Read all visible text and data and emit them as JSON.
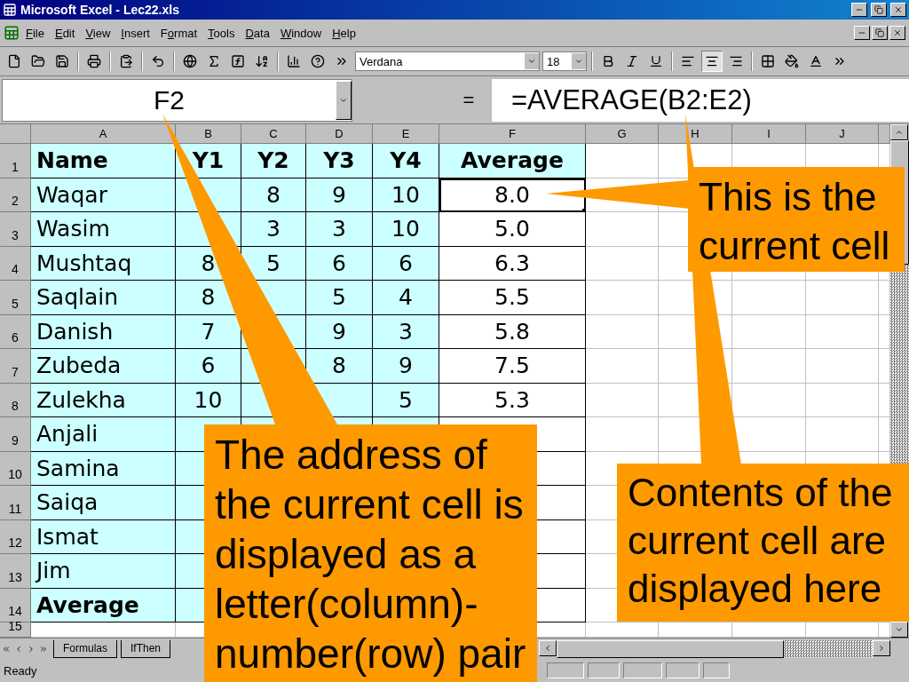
{
  "window": {
    "title": "Microsoft Excel - Lec22.xls"
  },
  "menu": [
    {
      "key": "F",
      "after": "ile"
    },
    {
      "key": "E",
      "after": "dit"
    },
    {
      "key": "V",
      "after": "iew"
    },
    {
      "key": "I",
      "after": "nsert"
    },
    {
      "before": "F",
      "key": "o",
      "after": "rmat"
    },
    {
      "key": "T",
      "after": "ools"
    },
    {
      "key": "D",
      "after": "ata"
    },
    {
      "key": "W",
      "after": "indow"
    },
    {
      "key": "H",
      "after": "elp"
    }
  ],
  "toolbar": [
    {
      "kind": "new",
      "pressed": false
    },
    {
      "kind": "open",
      "pressed": false
    },
    {
      "kind": "save",
      "pressed": false
    },
    {
      "kind": "sep"
    },
    {
      "kind": "print",
      "pressed": false
    },
    {
      "kind": "sep"
    },
    {
      "kind": "paste",
      "pressed": false
    },
    {
      "kind": "sep"
    },
    {
      "kind": "undo",
      "pressed": false
    },
    {
      "kind": "sep"
    },
    {
      "kind": "web",
      "pressed": false
    },
    {
      "kind": "sum",
      "pressed": false
    },
    {
      "kind": "function",
      "pressed": false
    },
    {
      "kind": "sort",
      "pressed": false
    },
    {
      "kind": "sep"
    },
    {
      "kind": "chart",
      "pressed": false
    },
    {
      "kind": "help",
      "pressed": false
    },
    {
      "kind": "more",
      "pressed": false
    }
  ],
  "font": {
    "name": "Verdana",
    "size": "18"
  },
  "format_toolbar": [
    {
      "kind": "bold",
      "pressed": false
    },
    {
      "kind": "italic",
      "pressed": false
    },
    {
      "kind": "underline",
      "pressed": false
    },
    {
      "kind": "sep"
    },
    {
      "kind": "align-left",
      "pressed": false
    },
    {
      "kind": "align-center",
      "pressed": true
    },
    {
      "kind": "align-right",
      "pressed": false
    },
    {
      "kind": "sep"
    },
    {
      "kind": "borders",
      "pressed": false
    },
    {
      "kind": "fill",
      "pressed": false
    },
    {
      "kind": "font-color",
      "pressed": false
    },
    {
      "kind": "more",
      "pressed": false
    }
  ],
  "formula_bar": {
    "name_box": "F2",
    "equals": "=",
    "formula": "=AVERAGE(B2:E2)"
  },
  "columns": [
    "A",
    "B",
    "C",
    "D",
    "E",
    "F",
    "G",
    "H",
    "I",
    "J"
  ],
  "rows": [
    {
      "number": "1",
      "kind": "header",
      "cells": [
        "Name",
        "Y1",
        "Y2",
        "Y3",
        "Y4",
        "Average"
      ]
    },
    {
      "number": "2",
      "kind": "data",
      "cells": [
        "Waqar",
        null,
        "8",
        "9",
        "10",
        {
          "text": "8.0",
          "selected": true
        }
      ]
    },
    {
      "number": "3",
      "kind": "data",
      "cells": [
        "Wasim",
        null,
        "3",
        "3",
        "10",
        "5.0"
      ]
    },
    {
      "number": "4",
      "kind": "data",
      "cells": [
        "Mushtaq",
        "8",
        "5",
        "6",
        "6",
        "6.3"
      ]
    },
    {
      "number": "5",
      "kind": "data",
      "cells": [
        "Saqlain",
        "8",
        null,
        "5",
        "4",
        "5.5"
      ]
    },
    {
      "number": "6",
      "kind": "data",
      "cells": [
        "Danish",
        "7",
        null,
        "9",
        "3",
        "5.8"
      ]
    },
    {
      "number": "7",
      "kind": "data",
      "cells": [
        "Zubeda",
        "6",
        null,
        "8",
        "9",
        "7.5"
      ]
    },
    {
      "number": "8",
      "kind": "data",
      "cells": [
        "Zulekha",
        "10",
        null,
        null,
        "5",
        "5.3"
      ]
    },
    {
      "number": "9",
      "kind": "data",
      "cells": [
        "Anjali"
      ]
    },
    {
      "number": "10",
      "kind": "data",
      "cells": [
        "Samina"
      ]
    },
    {
      "number": "11",
      "kind": "data",
      "cells": [
        "Saiqa"
      ]
    },
    {
      "number": "12",
      "kind": "data",
      "cells": [
        "Ismat"
      ]
    },
    {
      "number": "13",
      "kind": "data",
      "cells": [
        "Jim"
      ]
    },
    {
      "number": "14",
      "kind": "total",
      "cells": [
        "Average"
      ]
    },
    {
      "number": "15",
      "kind": "empty",
      "cells": []
    }
  ],
  "sheet_tabs": [
    {
      "label": "Formulas",
      "selected": false
    },
    {
      "label": "IfThen",
      "selected": false
    }
  ],
  "status_bar": {
    "text": "Ready"
  },
  "callouts": [
    {
      "kind": "address",
      "text": "The address of the current cell is displayed as a letter(column)-number(row) pair"
    },
    {
      "kind": "current",
      "text": "This is the current cell"
    },
    {
      "kind": "contents",
      "text": "Contents of the current cell are displayed here"
    }
  ]
}
